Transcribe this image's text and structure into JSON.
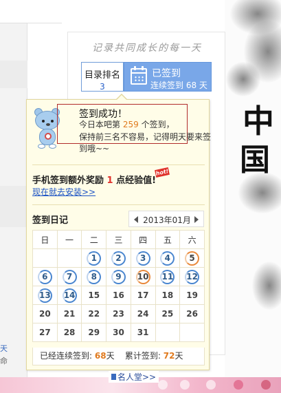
{
  "header": {
    "slogan": "记录共同成长的每一天"
  },
  "rank": {
    "label": "目录排名",
    "value": "3"
  },
  "signed_button": {
    "title": "已签到",
    "streak_text": "连续签到 68 天"
  },
  "popup": {
    "success_title": "签到成功！",
    "rank_prefix": "今日本吧第",
    "rank_number": "259",
    "rank_suffix": "个签到，",
    "advice_line1": "保持前三名不容易，记得明天要来签",
    "advice_line2": "到哦~~",
    "promo_prefix": "手机签到额外奖励",
    "promo_number": "1",
    "promo_suffix": "点经验值!",
    "hot_badge": "hot!",
    "install_link": "现在就去安装>>",
    "diary_title": "签到日记",
    "month_label": "2013年01月",
    "weekdays": [
      "日",
      "一",
      "二",
      "三",
      "四",
      "五",
      "六"
    ],
    "weeks": [
      [
        "",
        "",
        "1",
        "2",
        "3",
        "4",
        "5"
      ],
      [
        "6",
        "7",
        "8",
        "9",
        "10",
        "11",
        "12"
      ],
      [
        "13",
        "14",
        "15",
        "16",
        "17",
        "18",
        "19"
      ],
      [
        "20",
        "21",
        "22",
        "23",
        "24",
        "25",
        "26"
      ],
      [
        "27",
        "28",
        "29",
        "30",
        "31",
        "",
        ""
      ]
    ],
    "signed_days": [
      "1",
      "2",
      "3",
      "4",
      "6",
      "7",
      "8",
      "9",
      "11",
      "12",
      "13",
      "14"
    ],
    "highlight_days": [
      "5",
      "10"
    ],
    "stats": {
      "streak_label": "已经连续签到:",
      "streak_value": "68",
      "streak_unit": "天",
      "total_label": "累计签到:",
      "total_value": "72",
      "total_unit": "天"
    }
  },
  "footer": {
    "famous_link": "名人堂>>"
  },
  "left_edge": {
    "text1": "天",
    "text2": "命"
  },
  "colors": {
    "accent_blue": "#79a7e8",
    "signed_ring": "#4a86cf",
    "highlight_ring": "#e8883a",
    "number_orange": "#e07a1e"
  }
}
